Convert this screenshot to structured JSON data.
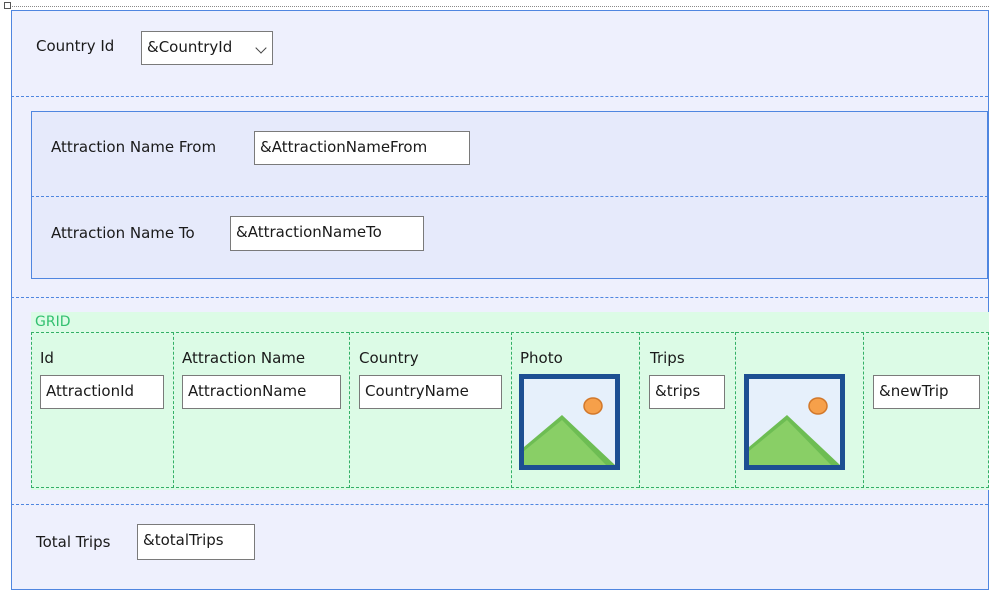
{
  "country_section": {
    "label": "Country Id",
    "dropdown_value": "&CountryId"
  },
  "filter_section": {
    "from_label": "Attraction Name From",
    "from_value": "&AttractionNameFrom",
    "to_label": "Attraction Name To",
    "to_value": "&AttractionNameTo"
  },
  "grid": {
    "title": "GRID",
    "columns": [
      {
        "header": "Id",
        "field": "AttractionId"
      },
      {
        "header": "Attraction Name",
        "field": "AttractionName"
      },
      {
        "header": "Country",
        "field": "CountryName"
      },
      {
        "header": "Photo",
        "field": "image-placeholder-icon"
      },
      {
        "header": "Trips",
        "field": "&trips"
      },
      {
        "header": "",
        "field": "image-placeholder-icon"
      },
      {
        "header": "",
        "field": "&newTrip"
      }
    ]
  },
  "total_section": {
    "label": "Total Trips",
    "value": "&totalTrips"
  },
  "colors": {
    "form_border": "#4f86e0",
    "form_background": "#eef0fd",
    "grid_background": "#dcfbe6",
    "grid_title": "#33c070"
  }
}
